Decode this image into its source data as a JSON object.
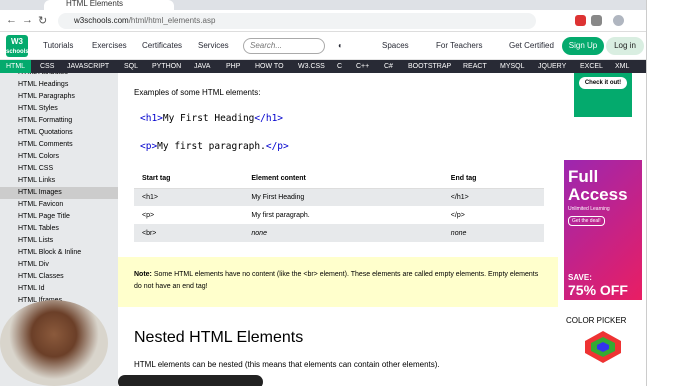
{
  "browser": {
    "tab_title": "HTML Elements",
    "url_domain": "w3schools.com",
    "url_path": "/html/html_elements.asp"
  },
  "header": {
    "logo_top": "W3",
    "logo_bottom": "schools",
    "menu": [
      "Tutorials",
      "Exercises",
      "Certificates",
      "Services"
    ],
    "search_placeholder": "Search...",
    "spaces": "Spaces",
    "teachers": "For Teachers",
    "certified": "Get Certified",
    "signup": "Sign Up",
    "login": "Log in"
  },
  "topnav": [
    "HTML",
    "CSS",
    "JAVASCRIPT",
    "SQL",
    "PYTHON",
    "JAVA",
    "PHP",
    "HOW TO",
    "W3.CSS",
    "C",
    "C++",
    "C#",
    "BOOTSTRAP",
    "REACT",
    "MYSQL",
    "JQUERY",
    "EXCEL",
    "XML"
  ],
  "sidebar": [
    "HTML Attributes",
    "HTML Headings",
    "HTML Paragraphs",
    "HTML Styles",
    "HTML Formatting",
    "HTML Quotations",
    "HTML Comments",
    "HTML Colors",
    "HTML CSS",
    "HTML Links",
    "HTML Images",
    "HTML Favicon",
    "HTML Page Title",
    "HTML Tables",
    "HTML Lists",
    "HTML Block & Inline",
    "HTML Div",
    "HTML Classes",
    "HTML Id",
    "HTML Iframes"
  ],
  "main": {
    "intro": "Examples of some HTML elements:",
    "code1_open": "<h1>",
    "code1_text": "My First Heading",
    "code1_close": "</h1>",
    "code2_open": "<p>",
    "code2_text": "My first paragraph.",
    "code2_close": "</p>",
    "table": {
      "headers": [
        "Start tag",
        "Element content",
        "End tag"
      ],
      "rows": [
        [
          "<h1>",
          "My First Heading",
          "</h1>"
        ],
        [
          "<p>",
          "My first paragraph.",
          "</p>"
        ],
        [
          "<br>",
          "none",
          "none"
        ]
      ]
    },
    "note_label": "Note:",
    "note_text": " Some HTML elements have no content (like the <br> element). These elements are called empty elements. Empty elements do not have an end tag!",
    "h2": "Nested HTML Elements",
    "nested_text": "HTML elements can be nested (this means that elements can contain other elements)."
  },
  "ads": {
    "check": "Check it out!",
    "full": "Full Access",
    "unlimited": "Unlimited Learning",
    "deal": "Get the deal!",
    "save": "SAVE:",
    "off": "75% OFF",
    "color_picker": "COLOR PICKER"
  }
}
